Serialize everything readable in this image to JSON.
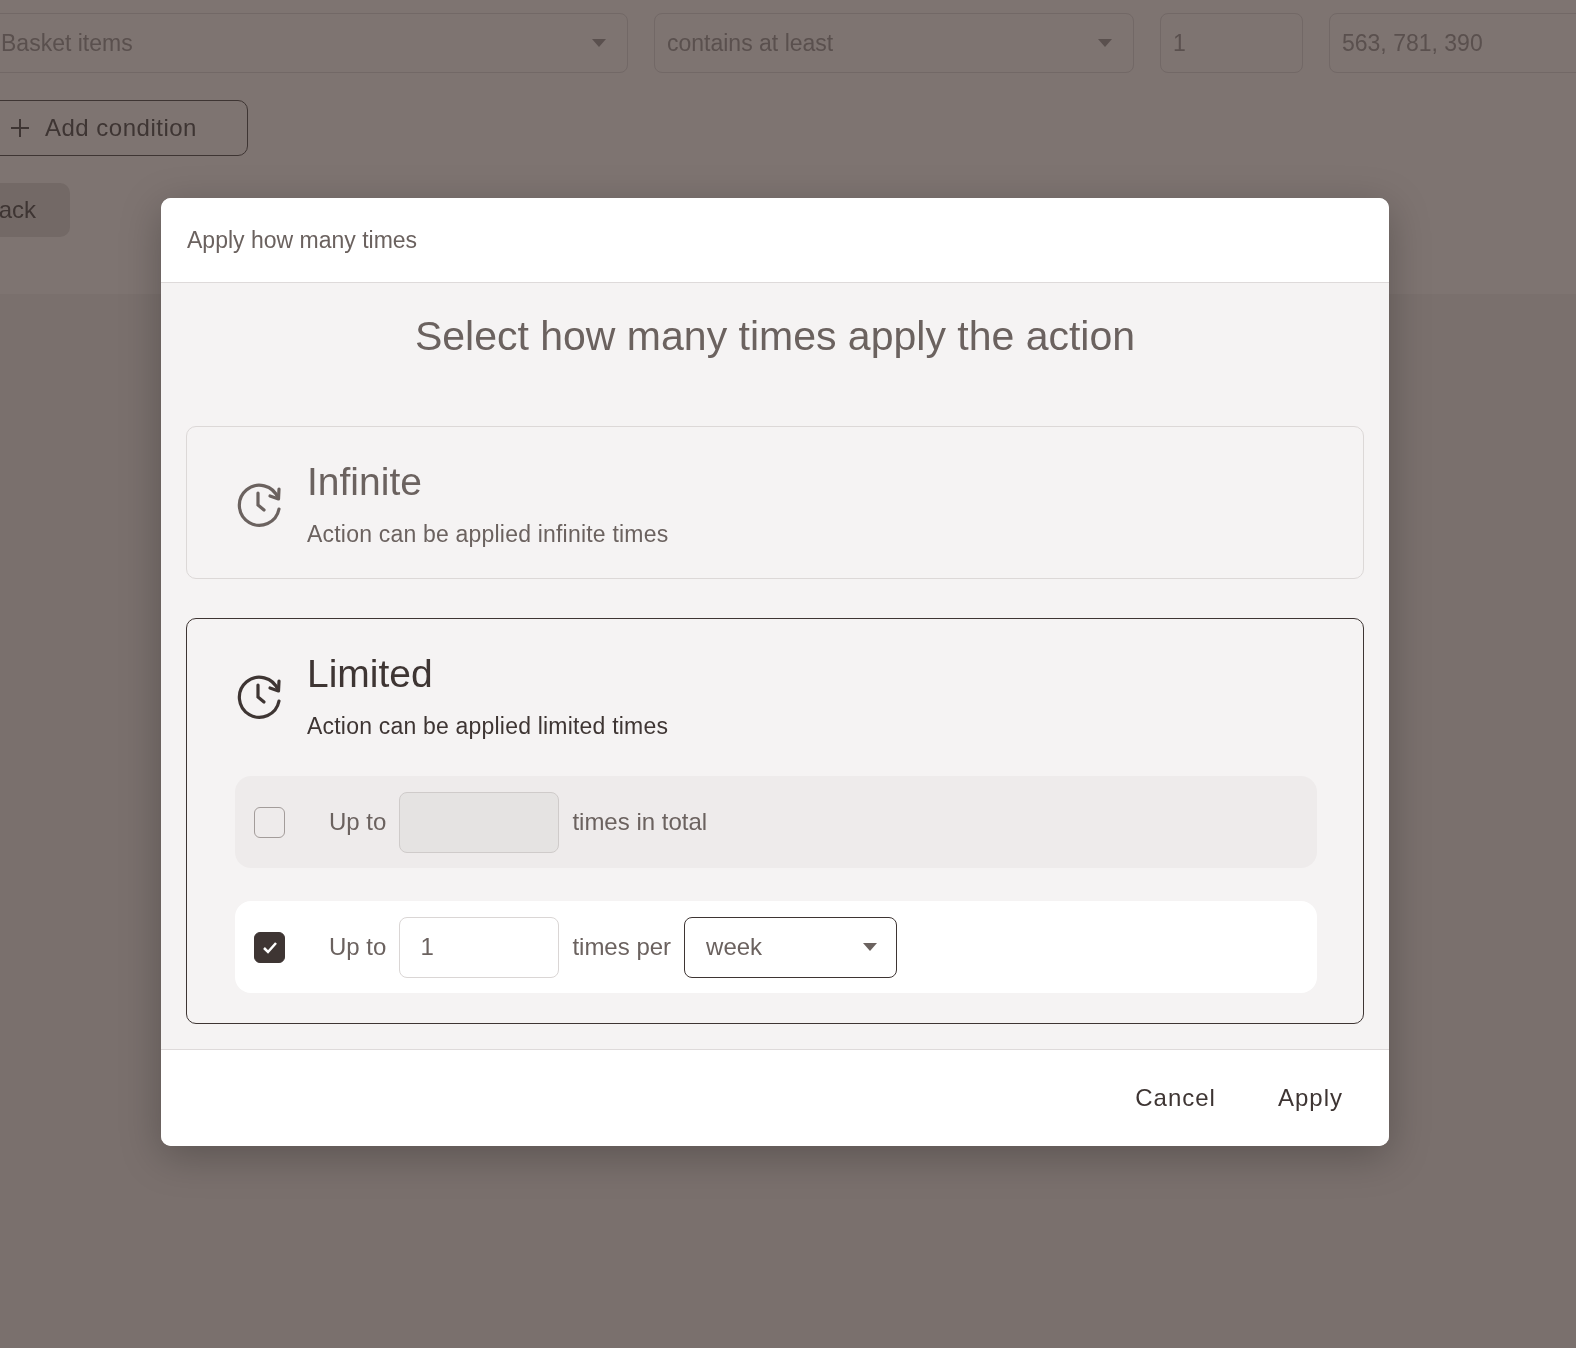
{
  "background": {
    "condition": {
      "field": "Basket items",
      "operator": "contains at least",
      "quantity": "1",
      "values": "563, 781, 390"
    },
    "add_condition": "Add condition",
    "back_button": "ack"
  },
  "dialog": {
    "title": "Apply how many times",
    "heading": "Select how many times apply the action",
    "options": [
      {
        "title": "Infinite",
        "description": "Action can be applied infinite times",
        "selected": false
      },
      {
        "title": "Limited",
        "description": "Action can be applied limited times",
        "selected": true,
        "limits": [
          {
            "kind": "total",
            "checked": false,
            "prefix": "Up to",
            "suffix": "times in total"
          },
          {
            "kind": "period",
            "checked": true,
            "prefix": "Up to",
            "value": "1",
            "suffix": "times per",
            "period": "week"
          }
        ]
      }
    ],
    "buttons": [
      {
        "label": "Cancel"
      },
      {
        "label": "Apply"
      }
    ]
  }
}
